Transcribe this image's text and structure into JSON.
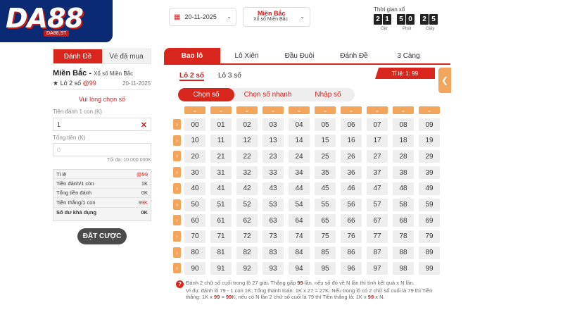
{
  "logo": {
    "text": "DA88",
    "sub": "DA88.ST"
  },
  "header": {
    "date": "20-11-2025",
    "region_title": "Miền Bắc",
    "region_sub": "Xổ số Miền Bắc",
    "timer_label": "Thời gian xổ",
    "timer_digits": [
      "2",
      "1",
      "5",
      "0",
      "2",
      "5"
    ],
    "timer_units": [
      "Giờ",
      "Phút",
      "Giây"
    ]
  },
  "left": {
    "tabs": [
      "Đánh Đề",
      "Vé đã mua"
    ],
    "title": "Miền Bắc -",
    "title_sub": "Xổ số Miền Bắc",
    "bet_type_prefix": "★ Lô 2 số",
    "bet_type_odds": "@99",
    "date": "20-11-2025",
    "prompt": "Vui lòng chọn số",
    "stake_label": "Tiền đánh 1 con (K)",
    "stake_value": "1",
    "total_label": "Tổng tiền (K)",
    "total_placeholder": "0",
    "max_note": "Tối đa: 10.000.000K",
    "summary": [
      {
        "label": "Tỉ lệ",
        "value": "@99",
        "red": true
      },
      {
        "label": "Tiền đánh/1 con",
        "value": "1K",
        "red": false
      },
      {
        "label": "Tổng tiền đánh",
        "value": "0K",
        "red": false
      },
      {
        "label": "Tiền thắng/1 con",
        "value": "99K",
        "red": true
      },
      {
        "label": "Số dư khả dụng",
        "value": "0K",
        "red": false
      }
    ],
    "bet_button": "ĐẶT CƯỢC"
  },
  "main": {
    "tabs": [
      "Bao lô",
      "Lô Xiên",
      "Đầu Đuôi",
      "Đánh Đề",
      "3 Càng"
    ],
    "subtabs": [
      "Lô 2 số",
      "Lô 3 số"
    ],
    "odds_badge": "Tỉ lệ: 1: 99",
    "modes": [
      "Chọn số",
      "Chọn số nhanh",
      "Nhập số"
    ],
    "numbers": [
      [
        "00",
        "01",
        "02",
        "03",
        "04",
        "05",
        "06",
        "07",
        "08",
        "09"
      ],
      [
        "10",
        "11",
        "12",
        "13",
        "14",
        "15",
        "16",
        "17",
        "18",
        "19"
      ],
      [
        "20",
        "21",
        "22",
        "23",
        "24",
        "25",
        "26",
        "27",
        "28",
        "29"
      ],
      [
        "30",
        "31",
        "32",
        "33",
        "34",
        "35",
        "36",
        "37",
        "38",
        "39"
      ],
      [
        "40",
        "41",
        "42",
        "43",
        "44",
        "45",
        "46",
        "47",
        "48",
        "49"
      ],
      [
        "50",
        "51",
        "52",
        "53",
        "54",
        "55",
        "56",
        "57",
        "58",
        "59"
      ],
      [
        "60",
        "61",
        "62",
        "63",
        "64",
        "65",
        "66",
        "67",
        "68",
        "69"
      ],
      [
        "70",
        "71",
        "72",
        "73",
        "74",
        "75",
        "76",
        "77",
        "78",
        "79"
      ],
      [
        "80",
        "81",
        "82",
        "83",
        "84",
        "85",
        "86",
        "87",
        "88",
        "89"
      ],
      [
        "90",
        "91",
        "92",
        "93",
        "94",
        "95",
        "96",
        "97",
        "98",
        "99"
      ]
    ],
    "note1_a": "Đánh 2 chữ số cuối trong lô 27 giải. Thắng gấp",
    "note1_b": "99",
    "note1_c": "lần, nếu số đó về N lần thì tính kết quả x N lần.",
    "note2_a": "Ví dụ: đánh lô 79 - 1 con 1K, Tổng thanh toán: 1K x 27 = 27K. Nếu trong lô có 2 chữ số cuối là 79 thì Tiền thắng: 1K x",
    "note2_b": "99",
    "note2_c": "=",
    "note2_d": "99",
    "note2_e": "K, nếu có N lần 2 chữ số cuối là 79 thì Tiền thắng là: 1K x",
    "note2_f": "99",
    "note2_g": "x N."
  },
  "colors": {
    "accent": "#d9261c",
    "orange": "#f3a55c",
    "logo_bg": "#0a2a74"
  },
  "icons": {
    "calendar": "calendar-icon",
    "chevron": "chevron-down-icon",
    "clear": "close-icon",
    "arrow": "chevron-left-icon",
    "help": "question-icon"
  }
}
